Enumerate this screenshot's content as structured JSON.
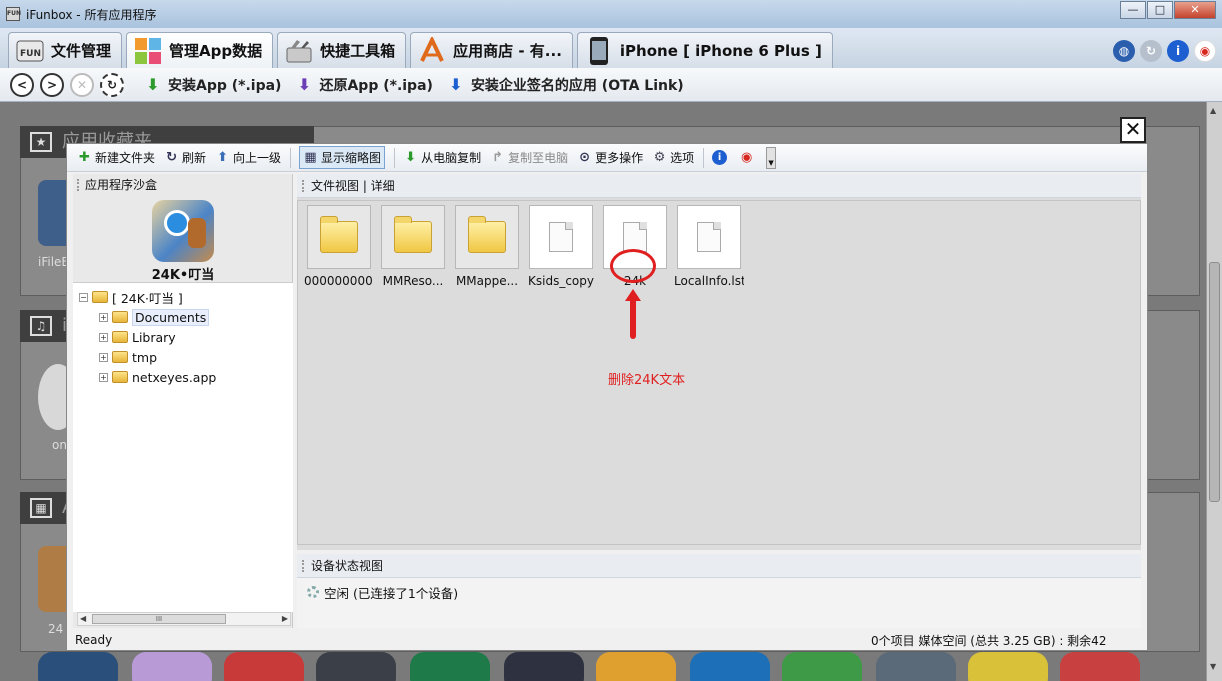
{
  "window": {
    "title": "iFunbox - 所有应用程序",
    "app_icon_text": "FUN",
    "controls": [
      "—",
      "□",
      "✕"
    ]
  },
  "tabs": [
    {
      "label": "文件管理",
      "icon": "fun-box-icon",
      "active": false
    },
    {
      "label": "管理App数据",
      "icon": "app-grid-icon",
      "active": true
    },
    {
      "label": "快捷工具箱",
      "icon": "toolbox-icon",
      "active": false
    },
    {
      "label": "应用商店 - 有...",
      "icon": "app-store-icon",
      "active": false
    },
    {
      "label": "iPhone [ iPhone 6 Plus ]",
      "icon": "iphone-icon",
      "active": false
    }
  ],
  "tab_right_icons": [
    "globe-icon",
    "refresh-icon",
    "info-icon",
    "weibo-icon"
  ],
  "toolbar2": {
    "install_app": "安装App (*.ipa)",
    "restore_app": "还原App (*.ipa)",
    "install_enterprise": "安装企业签名的应用  (OTA Link)"
  },
  "dashboard": {
    "section1_header": "应用收藏夹",
    "section2_header": "i",
    "section3_header": "A",
    "app1_label": "iFileE",
    "app2_label": "on",
    "app3_label": "24"
  },
  "dialog": {
    "toolbar": {
      "new_folder": "新建文件夹",
      "refresh": "刷新",
      "up_level": "向上一级",
      "show_thumbnails": "显示缩略图",
      "copy_from_pc": "从电脑复制",
      "copy_to_pc": "复制至电脑",
      "more_actions": "更多操作",
      "options": "选项"
    },
    "left": {
      "header": "应用程序沙盒",
      "app_name": "24K•叮当",
      "tree_root": "[ 24K·叮当 ]",
      "tree_items": [
        "Documents",
        "Library",
        "tmp",
        "netxeyes.app"
      ],
      "scroll_thumb": "III"
    },
    "right": {
      "header": "文件视图  |  详细",
      "files": [
        {
          "name": "000000000...",
          "type": "folder"
        },
        {
          "name": "MMReso...",
          "type": "folder"
        },
        {
          "name": "MMappe...",
          "type": "folder"
        },
        {
          "name": "Ksids_copy",
          "type": "file"
        },
        {
          "name": "24k",
          "type": "file"
        },
        {
          "name": "LocalInfo.lst",
          "type": "file"
        }
      ],
      "annotation": "删除24K文本"
    },
    "status_view": {
      "header": "设备状态视图",
      "status": "空闲  (已连接了1个设备)"
    },
    "statusbar": {
      "left": "Ready",
      "right": "0个项目   媒体空间 (总共 3.25 GB) : 剩余42"
    }
  }
}
